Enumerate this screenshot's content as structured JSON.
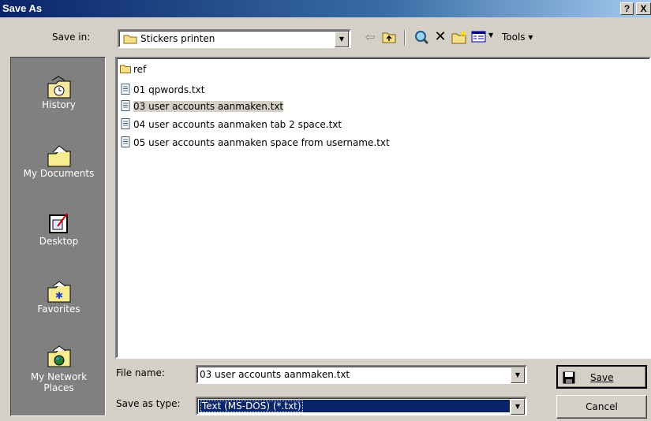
{
  "window": {
    "title": "Save As",
    "help_label": "?",
    "close_label": "X"
  },
  "toolbar": {
    "save_in_label": "Save in:",
    "save_in_value": "Stickers printen",
    "tools_label": "Tools ▾"
  },
  "places": [
    {
      "label": "History",
      "icon": "history-icon"
    },
    {
      "label": "My Documents",
      "icon": "my-documents-icon"
    },
    {
      "label": "Desktop",
      "icon": "desktop-icon"
    },
    {
      "label": "Favorites",
      "icon": "favorites-icon"
    },
    {
      "label": "My Network Places",
      "label1": "My Network",
      "label2": "Places",
      "icon": "network-places-icon"
    }
  ],
  "files": [
    {
      "name": "ref",
      "type": "folder",
      "selected": false
    },
    {
      "name": "01 qpwords.txt",
      "type": "text",
      "selected": false
    },
    {
      "name": "03 user accounts aanmaken.txt",
      "type": "text",
      "selected": true
    },
    {
      "name": "04 user accounts aanmaken tab 2 space.txt",
      "type": "text",
      "selected": false
    },
    {
      "name": "05 user accounts aanmaken space from username.txt",
      "type": "text",
      "selected": false
    }
  ],
  "form": {
    "file_name_label": "File name:",
    "file_name_value": "03 user accounts aanmaken.txt",
    "save_as_type_label": "Save as type:",
    "save_as_type_value": "Text (MS-DOS) (*.txt)"
  },
  "buttons": {
    "save_label": "Save",
    "cancel_label": "Cancel"
  },
  "colors": {
    "titlebar": "#0a246a",
    "selection": "#0a246a",
    "face": "#d4d0c8"
  }
}
